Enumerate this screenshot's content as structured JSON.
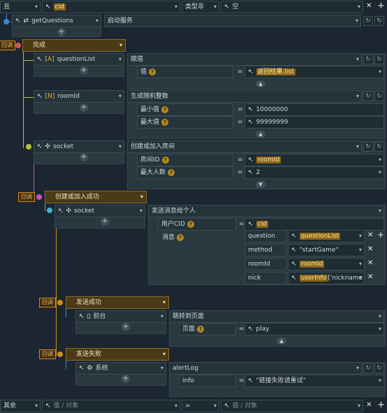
{
  "top": {
    "logic": "且",
    "var": "cid",
    "op": "类型非",
    "val": "空"
  },
  "bottom": {
    "else": "其余",
    "left_placeholder": "值 / 对象",
    "eq": "=",
    "right_placeholder": "值 / 对象"
  },
  "callback_label": "回调",
  "node_getq": {
    "name": "getQuestions",
    "action": "启动服务"
  },
  "complete": {
    "label": "完成"
  },
  "qlist": {
    "name": "questionList",
    "action": "赋值",
    "val_label": "值",
    "val_value": "返回结果.list"
  },
  "roomid_node": {
    "name": "roomId",
    "action": "生成随机整数",
    "min_label": "最小值",
    "min_value": "10000000",
    "max_label": "最大值",
    "max_value": "99999999"
  },
  "socket1": {
    "name": "socket",
    "action": "创建或加入房间",
    "room_label": "房间ID",
    "room_value": "roomId",
    "maxp_label": "最大人数",
    "maxp_value": "2"
  },
  "create_success": {
    "label": "创建或加入成功"
  },
  "socket2": {
    "name": "socket",
    "action": "发送消息给个人",
    "uid_label": "用户CID",
    "uid_value": "cid",
    "msg_label": "消息",
    "rows": [
      {
        "key": "question",
        "val": "questionList"
      },
      {
        "key": "method",
        "val": "\"startGame\""
      },
      {
        "key": "roomId",
        "val": "roomId"
      },
      {
        "key": "nick",
        "val_hl": "userInfo",
        "val_rest": "['nickname"
      }
    ]
  },
  "send_success": {
    "label": "发送成功"
  },
  "front": {
    "name": "前台",
    "action": "跳转到页面",
    "page_label": "页面",
    "page_value": "play"
  },
  "send_fail": {
    "label": "发送失败"
  },
  "system": {
    "name": "系统",
    "action": "alertLog",
    "info_label": "info",
    "info_value": "\"链接失败请重试\""
  },
  "colors": {
    "bg": "#1c2630",
    "cell": "#25333a",
    "accent_orange": "#d38b1c",
    "highlight": "#8a6514",
    "blue": "#3b88d8",
    "red": "#d9534f",
    "yellow_green": "#b7c43a",
    "magenta": "#c24fd0",
    "cyan": "#3fb3d0"
  },
  "icons": [
    "cursor-icon",
    "sync-icon",
    "array-icon",
    "number-icon",
    "socket-icon",
    "phone-icon",
    "gear-icon",
    "plus-icon",
    "chevron-down-icon",
    "close-icon",
    "refresh-icon"
  ]
}
